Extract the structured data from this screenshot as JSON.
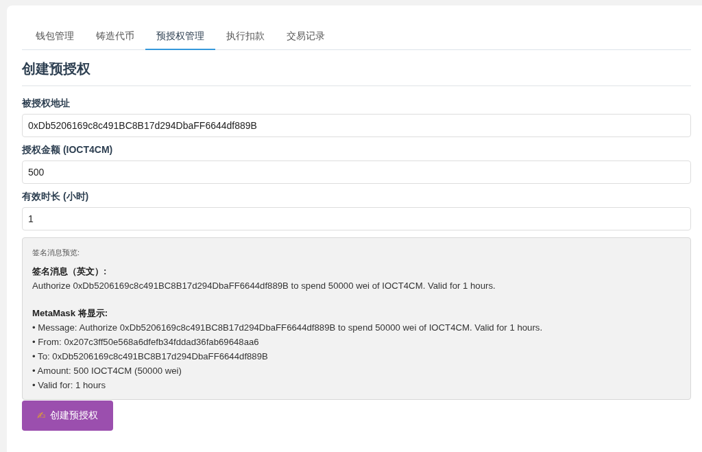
{
  "tabs": [
    {
      "label": "钱包管理",
      "selected": false
    },
    {
      "label": "铸造代币",
      "selected": false
    },
    {
      "label": "预授权管理",
      "selected": true
    },
    {
      "label": "执行扣款",
      "selected": false
    },
    {
      "label": "交易记录",
      "selected": false
    }
  ],
  "heading": "创建预授权",
  "fields": [
    {
      "label": "被授权地址",
      "value": "0xDb5206169c8c491BC8B17d294DbaFF6644df889B"
    },
    {
      "label": "授权金额 (IOCT4CM)",
      "value": "500"
    },
    {
      "label": "有效时长 (小时)",
      "value": "1"
    }
  ],
  "preview": {
    "title": "签名消息预览:",
    "message_heading": "签名消息（英文）:",
    "message": "Authorize 0xDb5206169c8c491BC8B17d294DbaFF6644df889B to spend 50000 wei of IOCT4CM. Valid for 1 hours.",
    "metamask_heading": "MetaMask 将显示:",
    "metamask_lines": [
      "• Message: Authorize 0xDb5206169c8c491BC8B17d294DbaFF6644df889B to spend 50000 wei of IOCT4CM. Valid for 1 hours.",
      "• From: 0x207c3ff50e568a6dfefb34fddad36fab69648aa6",
      "• To: 0xDb5206169c8c491BC8B17d294DbaFF6644df889B",
      "• Amount: 500 IOCT4CM (50000 wei)",
      "• Valid for: 1 hours"
    ]
  },
  "submit_button": {
    "icon": "✍",
    "label": "创建预授权"
  }
}
